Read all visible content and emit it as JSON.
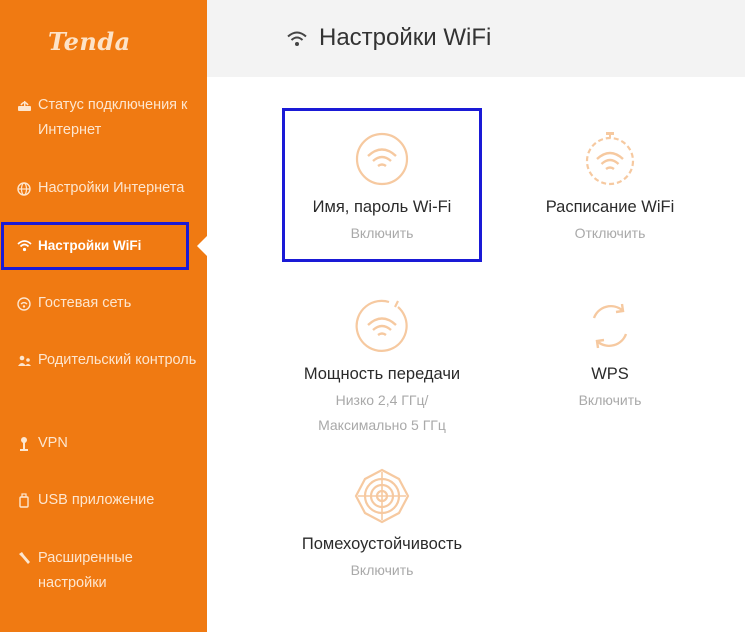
{
  "brand": {
    "logo_text": "Tenda",
    "accent_color": "#f07a12",
    "highlight_color": "#1a1ad6"
  },
  "sidebar": {
    "items": [
      {
        "label": "Статус подключения к Интернет",
        "icon": "router-status-icon",
        "active": false
      },
      {
        "label": "Настройки Интернета",
        "icon": "globe-icon",
        "active": false
      },
      {
        "label": "Настройки WiFi",
        "icon": "wifi-icon",
        "active": true
      },
      {
        "label": "Гостевая сеть",
        "icon": "guest-wifi-icon",
        "active": false
      },
      {
        "label": "Родительский контроль",
        "icon": "parental-control-icon",
        "active": false
      },
      {
        "label": "VPN",
        "icon": "vpn-key-icon",
        "active": false
      },
      {
        "label": "USB приложение",
        "icon": "usb-icon",
        "active": false
      },
      {
        "label": "Расширенные настройки",
        "icon": "tools-icon",
        "active": false
      }
    ]
  },
  "header": {
    "title": "Настройки WiFi",
    "icon": "wifi-icon"
  },
  "tiles": [
    {
      "title": "Имя, пароль Wi-Fi",
      "status": "Включить",
      "icon": "wifi-name-icon"
    },
    {
      "title": "Расписание WiFi",
      "status": "Отключить",
      "icon": "wifi-schedule-icon"
    },
    {
      "title": "Мощность передачи",
      "status": "Низко 2,4 ГГц/ Максимально 5 ГГц",
      "icon": "wifi-power-icon"
    },
    {
      "title": "WPS",
      "status": "Включить",
      "icon": "wps-icon"
    },
    {
      "title": "Помехоустойчивость",
      "status": "Включить",
      "icon": "anti-interference-icon"
    }
  ]
}
